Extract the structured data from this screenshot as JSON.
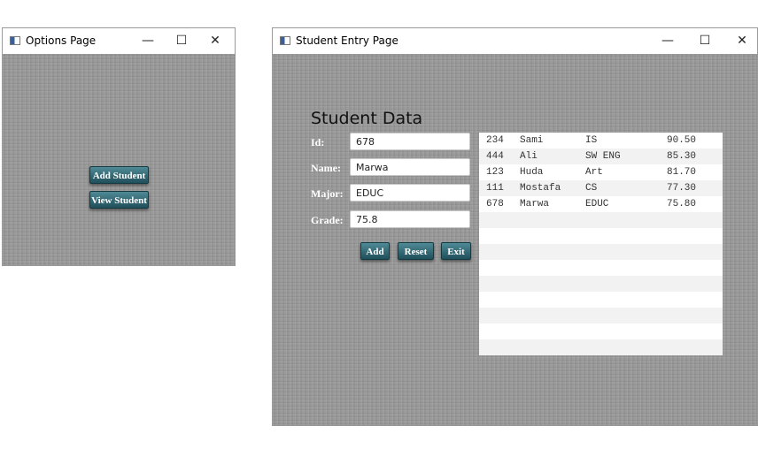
{
  "options_window": {
    "title": "Options Page",
    "controls": {
      "minimize": "—",
      "maximize": "☐",
      "close": "✕"
    },
    "buttons": {
      "add_student": "Add Student",
      "view_student": "View Student"
    }
  },
  "entry_window": {
    "title": "Student Entry Page",
    "controls": {
      "minimize": "—",
      "maximize": "☐",
      "close": "✕"
    },
    "form": {
      "title": "Student Data",
      "id_label": "Id:",
      "id_value": "678",
      "name_label": "Name:",
      "name_value": "Marwa",
      "major_label": "Major:",
      "major_value": "EDUC",
      "grade_label": "Grade:",
      "grade_value": "75.8"
    },
    "buttons": {
      "add": "Add",
      "reset": "Reset",
      "exit": "Exit"
    },
    "table": {
      "rows": [
        {
          "id": "234",
          "name": "Sami",
          "major": "IS",
          "grade": "90.50"
        },
        {
          "id": "444",
          "name": "Ali",
          "major": "SW ENG",
          "grade": "85.30"
        },
        {
          "id": "123",
          "name": "Huda",
          "major": "Art",
          "grade": "81.70"
        },
        {
          "id": "111",
          "name": "Mostafa",
          "major": "CS",
          "grade": "77.30"
        },
        {
          "id": "678",
          "name": "Marwa",
          "major": "EDUC",
          "grade": "75.80"
        }
      ],
      "empty_row_count": 9
    }
  },
  "colors": {
    "button_top": "#4f8a96",
    "button_bottom": "#1f4f5a",
    "background_texture": "#9a9a9a"
  }
}
